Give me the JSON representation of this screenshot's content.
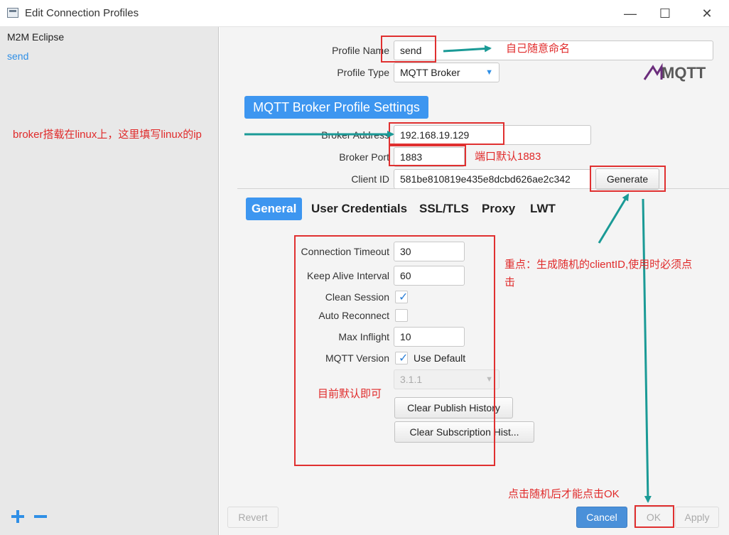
{
  "window": {
    "title": "Edit Connection Profiles",
    "controls": [
      "minimize",
      "maximize",
      "close"
    ]
  },
  "sidebar": {
    "items": [
      {
        "label": "M2M Eclipse",
        "selected": false
      },
      {
        "label": "send",
        "selected": true
      }
    ],
    "add_icon": "plus-icon",
    "remove_icon": "minus-icon"
  },
  "profile": {
    "name_label": "Profile Name",
    "name_value": "send",
    "type_label": "Profile Type",
    "type_value": "MQTT Broker",
    "logo_text": "MQTT"
  },
  "broker_settings": {
    "header": "MQTT Broker Profile Settings",
    "address_label": "Broker Address",
    "address_value": "192.168.19.129",
    "port_label": "Broker Port",
    "port_value": "1883",
    "client_id_label": "Client ID",
    "client_id_value": "581be810819e435e8dcbd626ae2c342",
    "generate_label": "Generate"
  },
  "tabs": [
    {
      "label": "General",
      "active": true
    },
    {
      "label": "User Credentials",
      "active": false
    },
    {
      "label": "SSL/TLS",
      "active": false
    },
    {
      "label": "Proxy",
      "active": false
    },
    {
      "label": "LWT",
      "active": false
    }
  ],
  "general": {
    "connection_timeout_label": "Connection Timeout",
    "connection_timeout_value": "30",
    "keep_alive_label": "Keep Alive Interval",
    "keep_alive_value": "60",
    "clean_session_label": "Clean Session",
    "clean_session_checked": true,
    "auto_reconnect_label": "Auto Reconnect",
    "auto_reconnect_checked": false,
    "max_inflight_label": "Max Inflight",
    "max_inflight_value": "10",
    "mqtt_version_label": "MQTT Version",
    "use_default_label": "Use Default",
    "use_default_checked": true,
    "version_value": "3.1.1",
    "clear_publish_label": "Clear Publish History",
    "clear_subscription_label": "Clear Subscription Hist..."
  },
  "footer": {
    "revert_label": "Revert",
    "cancel_label": "Cancel",
    "ok_label": "OK",
    "apply_label": "Apply"
  },
  "annotations": {
    "profile_name_note": "自己随意命名",
    "broker_note": "broker搭载在linux上，这里填写linux的ip",
    "port_note": "端口默认1883",
    "generate_note_line1": "重点：生成随机的clientID,使用时必须点",
    "generate_note_line2": "击",
    "default_note": "目前默认即可",
    "ok_note": "点击随机后才能点击OK"
  },
  "colors": {
    "accent": "#3d96f0",
    "annotation_red": "#e02a2a",
    "arrow_teal": "#1a9a96"
  }
}
